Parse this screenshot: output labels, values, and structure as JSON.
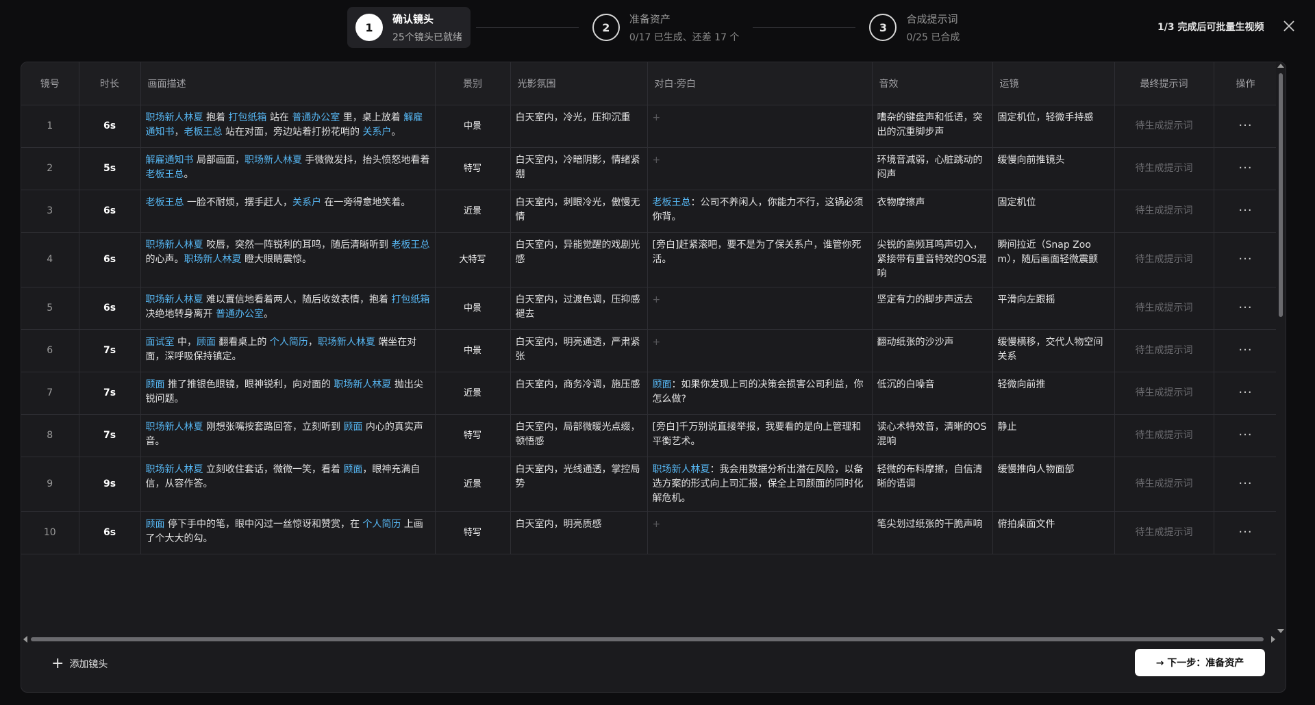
{
  "stepper": {
    "steps": [
      {
        "num": "1",
        "title": "确认镜头",
        "sub": "25个镜头已就绪"
      },
      {
        "num": "2",
        "title": "准备资产",
        "sub": "0/17 已生成、还差 17 个"
      },
      {
        "num": "3",
        "title": "合成提示词",
        "sub": "0/25 已合成"
      }
    ]
  },
  "top_status": "1/3 完成后可批量生视频",
  "table": {
    "headers": [
      "镜号",
      "时长",
      "画面描述",
      "景别",
      "光影氛围",
      "对白·旁白",
      "音效",
      "运镜",
      "最终提示词",
      "操作"
    ],
    "pending_label": "待生成提示词",
    "empty_dialog": "+",
    "rows": [
      {
        "idx": "1",
        "dur": "6s",
        "desc": [
          {
            "t": "职场新人林夏",
            "tag": true
          },
          {
            "t": " 抱着 "
          },
          {
            "t": "打包纸箱",
            "tag": true
          },
          {
            "t": " 站在 "
          },
          {
            "t": "普通办公室",
            "tag": true
          },
          {
            "t": " 里，桌上放着 "
          },
          {
            "t": "解雇通知书",
            "tag": true
          },
          {
            "t": "，"
          },
          {
            "t": "老板王总",
            "tag": true
          },
          {
            "t": " 站在对面，旁边站着打扮花哨的 "
          },
          {
            "t": "关系户",
            "tag": true
          },
          {
            "t": "。"
          }
        ],
        "shot": "中景",
        "light": "白天室内，冷光，压抑沉重",
        "dialog": [],
        "sound": "嘈杂的键盘声和低语，突出的沉重脚步声",
        "camera": "固定机位，轻微手持感"
      },
      {
        "idx": "2",
        "dur": "5s",
        "desc": [
          {
            "t": "解雇通知书",
            "tag": true
          },
          {
            "t": " 局部画面，"
          },
          {
            "t": "职场新人林夏",
            "tag": true
          },
          {
            "t": " 手微微发抖，抬头愤怒地看着 "
          },
          {
            "t": "老板王总",
            "tag": true
          },
          {
            "t": "。"
          }
        ],
        "shot": "特写",
        "light": "白天室内，冷暗阴影，情绪紧绷",
        "dialog": [],
        "sound": "环境音减弱，心脏跳动的闷声",
        "camera": "缓慢向前推镜头"
      },
      {
        "idx": "3",
        "dur": "6s",
        "desc": [
          {
            "t": "老板王总",
            "tag": true
          },
          {
            "t": " 一脸不耐烦，摆手赶人，"
          },
          {
            "t": "关系户",
            "tag": true
          },
          {
            "t": " 在一旁得意地笑着。"
          }
        ],
        "shot": "近景",
        "light": "白天室内，刺眼冷光，傲慢无情",
        "dialog": [
          {
            "t": "老板王总",
            "tag": true
          },
          {
            "t": "：公司不养闲人，你能力不行，这锅必须你背。"
          }
        ],
        "sound": "衣物摩擦声",
        "camera": "固定机位"
      },
      {
        "idx": "4",
        "dur": "6s",
        "desc": [
          {
            "t": "职场新人林夏",
            "tag": true
          },
          {
            "t": " 咬唇，突然一阵锐利的耳鸣，随后清晰听到 "
          },
          {
            "t": "老板王总",
            "tag": true
          },
          {
            "t": " 的心声。"
          },
          {
            "t": "职场新人林夏",
            "tag": true
          },
          {
            "t": " 瞪大眼睛震惊。"
          }
        ],
        "shot": "大特写",
        "light": "白天室内，异能觉醒的戏剧光感",
        "dialog": [
          {
            "t": "[旁白]赶紧滚吧，要不是为了保关系户，谁管你死活。"
          }
        ],
        "sound": "尖锐的高频耳鸣声切入，紧接带有重音特效的OS混响",
        "camera": "瞬间拉近（Snap Zoom），随后画面轻微震颤"
      },
      {
        "idx": "5",
        "dur": "6s",
        "desc": [
          {
            "t": "职场新人林夏",
            "tag": true
          },
          {
            "t": " 难以置信地看着两人，随后收敛表情，抱着 "
          },
          {
            "t": "打包纸箱",
            "tag": true
          },
          {
            "t": " 决绝地转身离开 "
          },
          {
            "t": "普通办公室",
            "tag": true
          },
          {
            "t": "。"
          }
        ],
        "shot": "中景",
        "light": "白天室内，过渡色调，压抑感褪去",
        "dialog": [],
        "sound": "坚定有力的脚步声远去",
        "camera": "平滑向左跟摇"
      },
      {
        "idx": "6",
        "dur": "7s",
        "desc": [
          {
            "t": "面试室",
            "tag": true
          },
          {
            "t": " 中，"
          },
          {
            "t": "顾面",
            "tag": true
          },
          {
            "t": " 翻看桌上的 "
          },
          {
            "t": "个人简历",
            "tag": true
          },
          {
            "t": "，"
          },
          {
            "t": "职场新人林夏",
            "tag": true
          },
          {
            "t": " 端坐在对面，深呼吸保持镇定。"
          }
        ],
        "shot": "中景",
        "light": "白天室内，明亮通透，严肃紧张",
        "dialog": [],
        "sound": "翻动纸张的沙沙声",
        "camera": "缓慢横移，交代人物空间关系"
      },
      {
        "idx": "7",
        "dur": "7s",
        "desc": [
          {
            "t": "顾面",
            "tag": true
          },
          {
            "t": " 推了推银色眼镜，眼神锐利，向对面的 "
          },
          {
            "t": "职场新人林夏",
            "tag": true
          },
          {
            "t": " 抛出尖锐问题。"
          }
        ],
        "shot": "近景",
        "light": "白天室内，商务冷调，施压感",
        "dialog": [
          {
            "t": "顾面",
            "tag": true
          },
          {
            "t": "：如果你发现上司的决策会损害公司利益，你怎么做?"
          }
        ],
        "sound": "低沉的白噪音",
        "camera": "轻微向前推"
      },
      {
        "idx": "8",
        "dur": "7s",
        "desc": [
          {
            "t": "职场新人林夏",
            "tag": true
          },
          {
            "t": " 刚想张嘴按套路回答，立刻听到 "
          },
          {
            "t": "顾面",
            "tag": true
          },
          {
            "t": " 内心的真实声音。"
          }
        ],
        "shot": "特写",
        "light": "白天室内，局部微暖光点缀，顿悟感",
        "dialog": [
          {
            "t": "[旁白]千万别说直接举报，我要看的是向上管理和平衡艺术。"
          }
        ],
        "sound": "读心术特效音，清晰的OS混响",
        "camera": "静止"
      },
      {
        "idx": "9",
        "dur": "9s",
        "desc": [
          {
            "t": "职场新人林夏",
            "tag": true
          },
          {
            "t": " 立刻收住套话，微微一笑，看着 "
          },
          {
            "t": "顾面",
            "tag": true
          },
          {
            "t": "，眼神充满自信，从容作答。"
          }
        ],
        "shot": "近景",
        "light": "白天室内，光线通透，掌控局势",
        "dialog": [
          {
            "t": "职场新人林夏",
            "tag": true
          },
          {
            "t": "：我会用数据分析出潜在风险，以备选方案的形式向上司汇报，保全上司颜面的同时化解危机。"
          }
        ],
        "sound": "轻微的布料摩擦，自信清晰的语调",
        "camera": "缓慢推向人物面部"
      },
      {
        "idx": "10",
        "dur": "6s",
        "desc": [
          {
            "t": "顾面",
            "tag": true
          },
          {
            "t": " 停下手中的笔，眼中闪过一丝惊讶和赞赏，在 "
          },
          {
            "t": "个人简历",
            "tag": true
          },
          {
            "t": " 上画了个大大的勾。"
          }
        ],
        "shot": "特写",
        "light": "白天室内，明亮质感",
        "dialog": [],
        "sound": "笔尖划过纸张的干脆声响",
        "camera": "俯拍桌面文件"
      }
    ]
  },
  "footer": {
    "add_label": "添加镜头",
    "next_label": "→ 下一步：准备资产"
  },
  "colors": {
    "tag": "#56b6f2",
    "background": "#0d0d0f",
    "panel": "#1b1b1e"
  },
  "icons": {
    "close": "close-icon",
    "more": "more-icon",
    "add": "plus-icon"
  }
}
